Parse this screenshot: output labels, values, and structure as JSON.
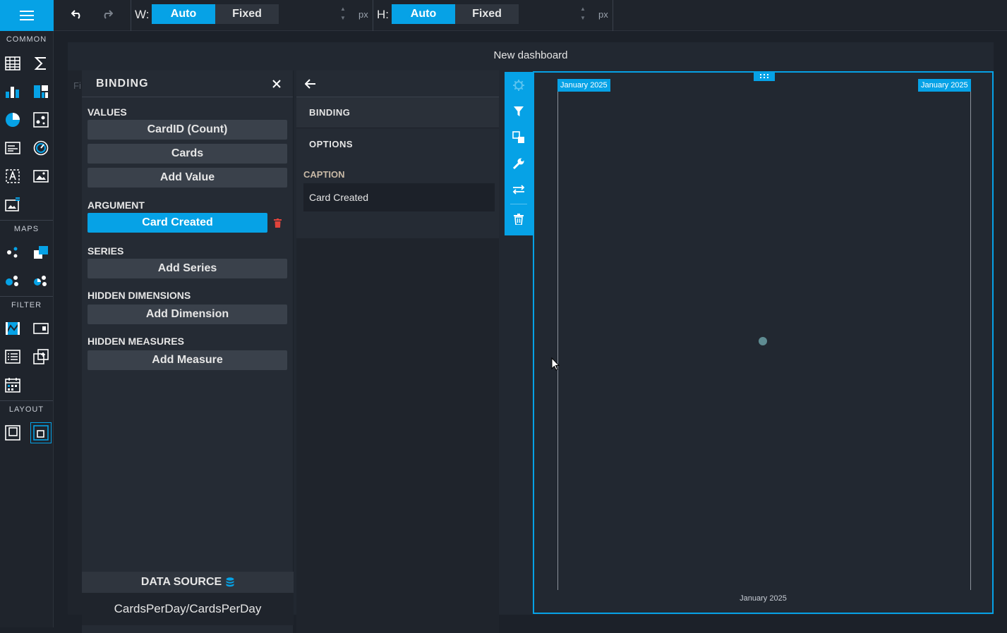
{
  "toolbox": {
    "sections": {
      "common": "COMMON",
      "maps": "MAPS",
      "filter": "FILTER",
      "layout": "LAYOUT"
    }
  },
  "topbar": {
    "width_label": "W:",
    "height_label": "H:",
    "auto_label": "Auto",
    "fixed_label": "Fixed",
    "unit": "px",
    "width_mode": "Auto",
    "height_mode": "Auto"
  },
  "dashboard": {
    "title": "New dashboard",
    "hidden_panel_text": "Fi"
  },
  "binding_panel": {
    "title": "BINDING",
    "values": {
      "title": "VALUES",
      "items": [
        "CardID (Count)",
        "Cards"
      ],
      "add": "Add Value"
    },
    "argument": {
      "title": "ARGUMENT",
      "item": "Card Created"
    },
    "series": {
      "title": "SERIES",
      "add": "Add Series"
    },
    "hidden_dimensions": {
      "title": "HIDDEN DIMENSIONS",
      "add": "Add Dimension"
    },
    "hidden_measures": {
      "title": "HIDDEN MEASURES",
      "add": "Add Measure"
    },
    "data_source": {
      "title": "DATA SOURCE",
      "value": "CardsPerDay/CardsPerDay"
    }
  },
  "options_panel": {
    "tabs": [
      "BINDING",
      "OPTIONS"
    ],
    "caption_label": "CAPTION",
    "caption_value": "Card Created"
  },
  "chart": {
    "range_start_label": "January 2025",
    "range_end_label": "January 2025",
    "axis_label": "January 2025",
    "accent": "#06a2e6",
    "point_color": "#5f8c92"
  }
}
